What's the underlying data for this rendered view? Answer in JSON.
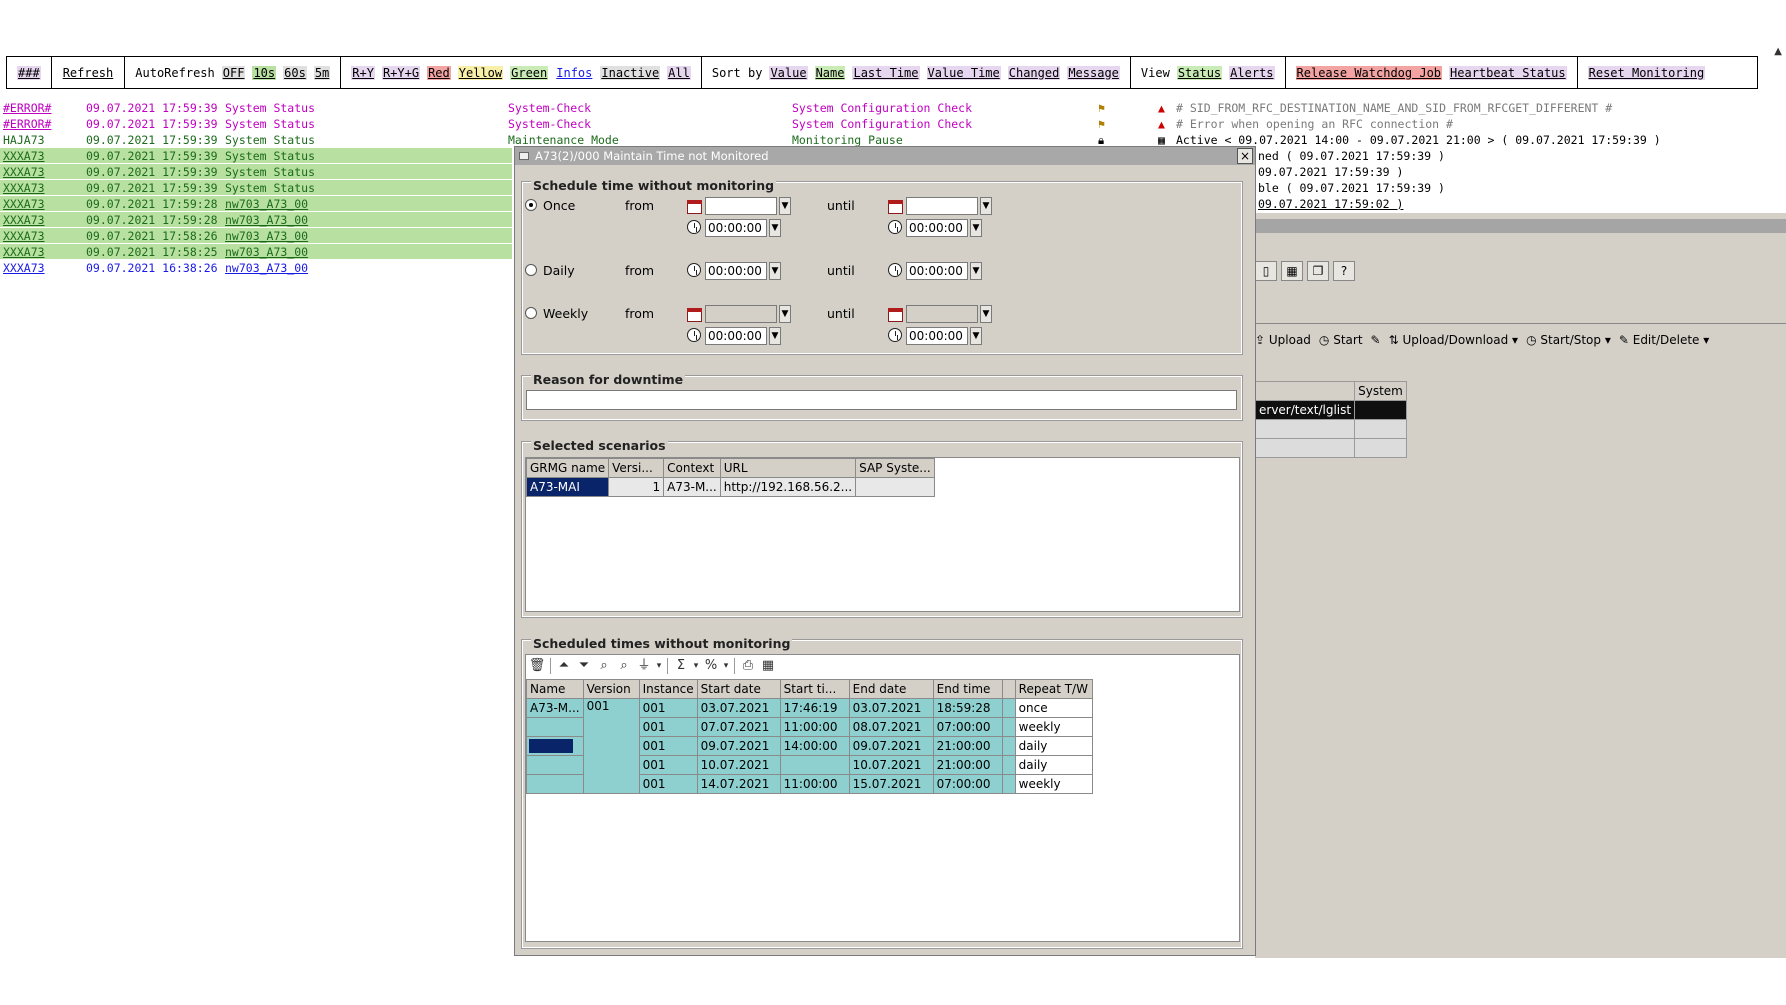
{
  "toolbar": {
    "menu_label": "###",
    "refresh": "Refresh",
    "autorefresh_label": "AutoRefresh",
    "autorefresh_options": [
      "OFF",
      "10s",
      "60s",
      "5m"
    ],
    "filters": [
      "R+Y",
      "R+Y+G",
      "Red",
      "Yellow",
      "Green",
      "Infos",
      "Inactive",
      "All"
    ],
    "sort_label": "Sort by",
    "sort_options": [
      "Value",
      "Name",
      "Last Time",
      "Value Time",
      "Changed",
      "Message"
    ],
    "view_label": "View",
    "view_options": [
      "Status",
      "Alerts"
    ],
    "release_watchdog": "Release Watchdog Job",
    "heartbeat_status": "Heartbeat Status",
    "reset_monitoring": "Reset Monitoring"
  },
  "alerts": [
    {
      "system": "#ERROR#",
      "datetime": "09.07.2021 17:59:39",
      "object": "System Status",
      "category": "System-Check",
      "msg_type": "System Configuration Check",
      "detail": "# SID_FROM_RFC_DESTINATION_NAME_AND_SID_FROM_RFCGET_DIFFERENT #"
    },
    {
      "system": "#ERROR#",
      "datetime": "09.07.2021 17:59:39",
      "object": "System Status",
      "category": "System-Check",
      "msg_type": "System Configuration Check",
      "detail": "# Error when opening an RFC connection #"
    },
    {
      "system": "HAJA73",
      "datetime": "09.07.2021 17:59:39",
      "object": "System Status",
      "category": "Maintenance Mode",
      "msg_type": "Monitoring Pause",
      "detail": "Active < 09.07.2021 14:00 - 09.07.2021 21:00 > ( 09.07.2021 17:59:39 )"
    },
    {
      "system": "XXXA73",
      "datetime": "09.07.2021 17:59:39",
      "object": "System Status",
      "category": "",
      "msg_type": "",
      "detail": "ned ( 09.07.2021 17:59:39 )"
    },
    {
      "system": "XXXA73",
      "datetime": "09.07.2021 17:59:39",
      "object": "System Status",
      "category": "",
      "msg_type": "",
      "detail": " 09.07.2021 17:59:39 )"
    },
    {
      "system": "XXXA73",
      "datetime": "09.07.2021 17:59:39",
      "object": "System Status",
      "category": "",
      "msg_type": "",
      "detail": "ble ( 09.07.2021 17:59:39 )"
    },
    {
      "system": "XXXA73",
      "datetime": "09.07.2021 17:59:28",
      "object": "nw703_A73_00",
      "category": "",
      "msg_type": "",
      "detail": "09.07.2021 17:59:02 )"
    },
    {
      "system": "XXXA73",
      "datetime": "09.07.2021 17:59:28",
      "object": "nw703_A73_00",
      "category": "",
      "msg_type": "",
      "detail": ""
    },
    {
      "system": "XXXA73",
      "datetime": "09.07.2021 17:58:26",
      "object": "nw703_A73_00",
      "category": "",
      "msg_type": "",
      "detail": ""
    },
    {
      "system": "XXXA73",
      "datetime": "09.07.2021 17:58:25",
      "object": "nw703_A73_00",
      "category": "",
      "msg_type": "",
      "detail": ""
    },
    {
      "system": "XXXA73",
      "datetime": "09.07.2021 16:38:26",
      "object": "nw703_A73_00",
      "category": "",
      "msg_type": "",
      "detail": ""
    }
  ],
  "bg_panel": {
    "actions": [
      "Upload",
      "Start",
      "Upload/Download",
      "Start/Stop",
      "Edit/Delete"
    ],
    "table_header": [
      "",
      "System"
    ],
    "table_rows": [
      [
        "erver/text/lglist",
        ""
      ],
      [
        "",
        ""
      ],
      [
        "",
        ""
      ]
    ]
  },
  "dialog": {
    "title": "A73(2)/000 Maintain Time not Monitored",
    "close": "×",
    "schedule": {
      "group_title": "Schedule time without monitoring",
      "once": "Once",
      "daily": "Daily",
      "weekly": "Weekly",
      "from": "from",
      "until": "until",
      "time_value": "00:00:00"
    },
    "reason": {
      "group_title": "Reason for downtime",
      "value": ""
    },
    "scenarios": {
      "group_title": "Selected scenarios",
      "headers": [
        "GRMG name",
        "Versi...",
        "Context",
        "URL",
        "SAP Syste..."
      ],
      "rows": [
        [
          "A73-MAI",
          "1",
          "A73-M...",
          "http://192.168.56.2...",
          ""
        ]
      ]
    },
    "scheduled": {
      "group_title": "Scheduled times without monitoring",
      "headers": [
        "Name",
        "Version",
        "Instance",
        "Start date",
        "Start ti...",
        "End date",
        "End time",
        "",
        "Repeat T/W"
      ],
      "rows": [
        [
          "A73-M...",
          "001",
          "001",
          "03.07.2021",
          "17:46:19",
          "03.07.2021",
          "18:59:28",
          "",
          "once"
        ],
        [
          "",
          "",
          "001",
          "07.07.2021",
          "11:00:00",
          "08.07.2021",
          "07:00:00",
          "",
          "weekly"
        ],
        [
          "",
          "",
          "001",
          "09.07.2021",
          "14:00:00",
          "09.07.2021",
          "21:00:00",
          "",
          "daily"
        ],
        [
          "",
          "",
          "001",
          "10.07.2021",
          "",
          "10.07.2021",
          "21:00:00",
          "",
          "daily"
        ],
        [
          "",
          "",
          "001",
          "14.07.2021",
          "11:00:00",
          "15.07.2021",
          "07:00:00",
          "",
          "weekly"
        ]
      ]
    }
  },
  "colors": {
    "green_row": "#b8e0a0",
    "dialog_bg": "#d4d0c8",
    "teal_cell": "#8ed0d0",
    "selection": "#0a246a"
  }
}
